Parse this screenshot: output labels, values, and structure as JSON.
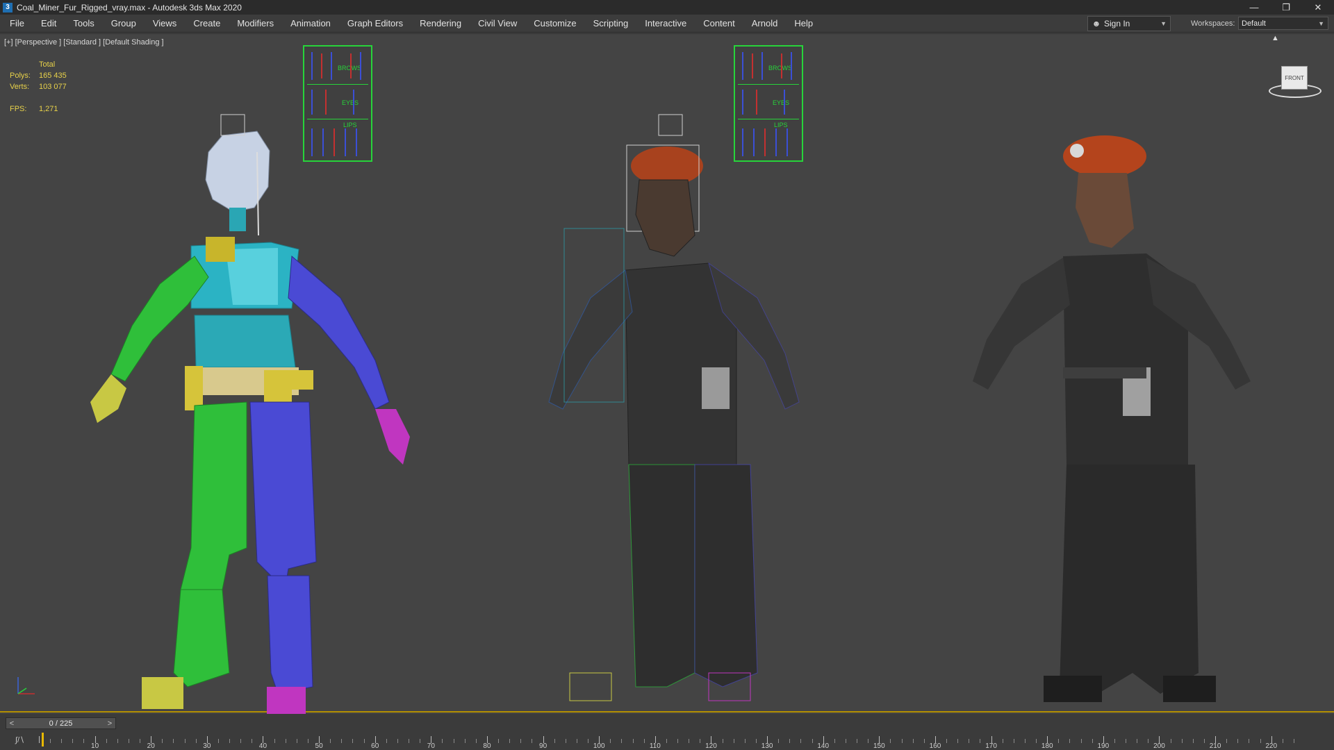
{
  "window": {
    "title": "Coal_Miner_Fur_Rigged_vray.max - Autodesk 3ds Max 2020",
    "app_icon": "3",
    "controls": [
      "—",
      "❐",
      "✕"
    ]
  },
  "menu": {
    "items": [
      "File",
      "Edit",
      "Tools",
      "Group",
      "Views",
      "Create",
      "Modifiers",
      "Animation",
      "Graph Editors",
      "Rendering",
      "Civil View",
      "Customize",
      "Scripting",
      "Interactive",
      "Content",
      "Arnold",
      "Help"
    ],
    "signin_label": "Sign In",
    "workspaces_label": "Workspaces:",
    "workspace_value": "Default"
  },
  "viewport": {
    "label": "[+] [Perspective ] [Standard ] [Default Shading ]",
    "stats": {
      "total_label": "Total",
      "polys_label": "Polys:",
      "polys_value": "165 435",
      "verts_label": "Verts:",
      "verts_value": "103 077",
      "fps_label": "FPS:",
      "fps_value": "1,271"
    },
    "viewcube_label": "FRONT",
    "panel_labels": [
      "BROWS",
      "EYES",
      "LIPS"
    ]
  },
  "timeline": {
    "slider_value": "0 / 225",
    "prev": "<",
    "next": ">",
    "ticks": [
      10,
      20,
      30,
      40,
      50,
      60,
      70,
      80,
      90,
      100,
      110,
      120,
      130,
      140,
      150,
      160,
      170,
      180,
      190,
      200,
      210,
      220
    ],
    "max_frame": 225
  }
}
